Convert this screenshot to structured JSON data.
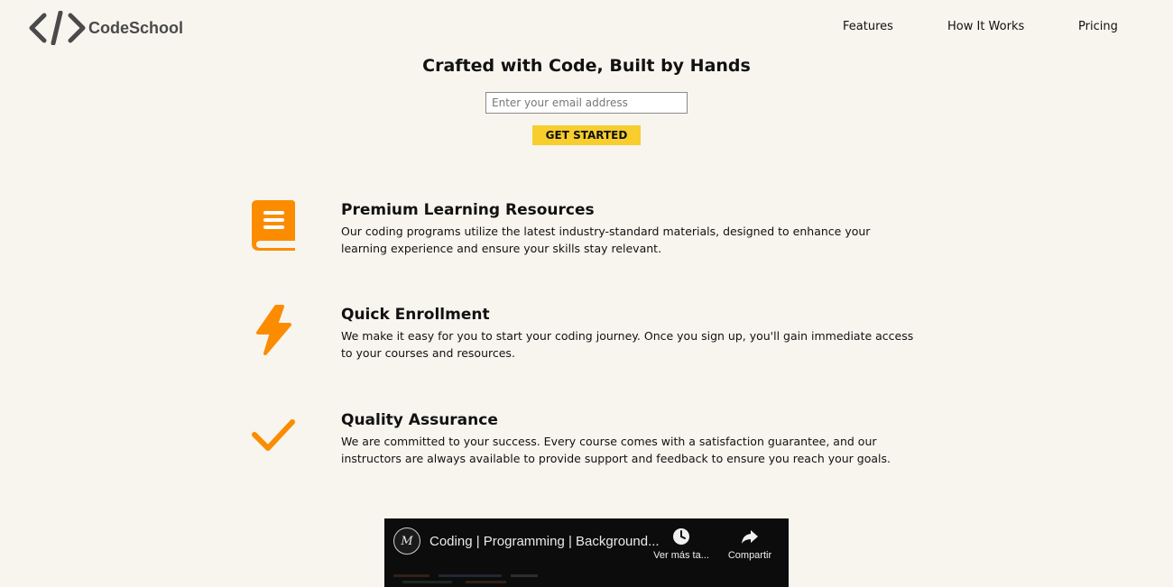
{
  "header": {
    "logo_text": "CodeSchool",
    "nav": {
      "features": "Features",
      "how_it_works": "How It Works",
      "pricing": "Pricing"
    }
  },
  "hero": {
    "title": "Crafted with Code, Built by Hands",
    "email_placeholder": "Enter your email address",
    "email_value": "",
    "cta_label": "GET STARTED"
  },
  "features": [
    {
      "icon": "book-icon",
      "title": "Premium Learning Resources",
      "description": "Our coding programs utilize the latest industry-standard materials, designed to enhance your learning experience and ensure your skills stay relevant."
    },
    {
      "icon": "lightning-bolt-icon",
      "title": "Quick Enrollment",
      "description": "We make it easy for you to start your coding journey. Once you sign up, you'll gain immediate access to your courses and resources."
    },
    {
      "icon": "checkmark-icon",
      "title": "Quality Assurance",
      "description": "We are committed to your success. Every course comes with a satisfaction guarantee, and our instructors are always available to provide support and feedback to ensure you reach your goals."
    }
  ],
  "video": {
    "channel_initial": "M",
    "title": "Coding | Programming | Background...",
    "watch_later_label": "Ver más ta...",
    "share_label": "Compartir"
  },
  "colors": {
    "background": "#f7f5ee",
    "accent_orange": "#fb8c00",
    "button_yellow": "#f8cd2e",
    "logo_gray": "#4a4a4a"
  }
}
